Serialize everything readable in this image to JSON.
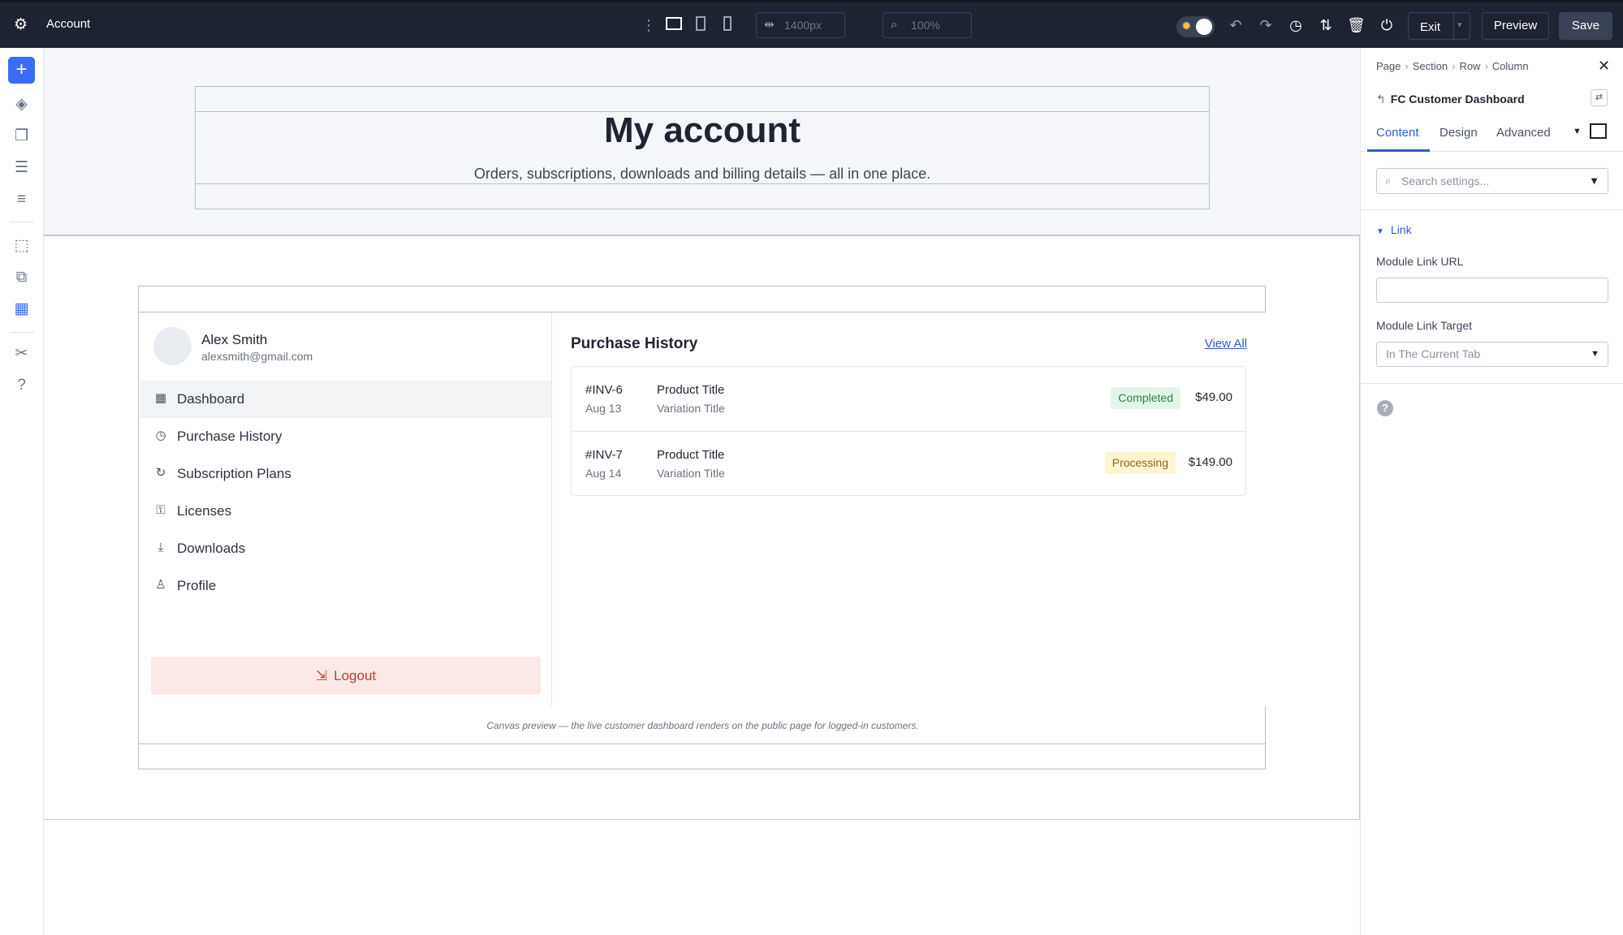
{
  "app": {
    "title": "Account"
  },
  "toolbar": {
    "width_value": "1400px",
    "zoom_value": "100%",
    "exit_label": "Exit",
    "preview_label": "Preview",
    "save_label": "Save"
  },
  "hero": {
    "title": "My account",
    "subtitle": "Orders, subscriptions, downloads and billing details — all in one place."
  },
  "user": {
    "name": "Alex Smith",
    "email": "alexsmith@gmail.com"
  },
  "nav": {
    "items": [
      {
        "label": "Dashboard",
        "icon": "grid-icon",
        "active": true
      },
      {
        "label": "Purchase History",
        "icon": "clock-icon"
      },
      {
        "label": "Subscription Plans",
        "icon": "refresh-icon"
      },
      {
        "label": "Licenses",
        "icon": "key-icon"
      },
      {
        "label": "Downloads",
        "icon": "download-icon"
      },
      {
        "label": "Profile",
        "icon": "user-icon"
      }
    ],
    "logout_label": "Logout"
  },
  "purchases": {
    "title": "Purchase History",
    "view_all": "View All",
    "orders": [
      {
        "id": "#INV-6",
        "date": "Aug 13",
        "product": "Product Title",
        "variation": "Variation Title",
        "status": "Completed",
        "price": "$49.00"
      },
      {
        "id": "#INV-7",
        "date": "Aug 14",
        "product": "Product Title",
        "variation": "Variation Title",
        "status": "Processing",
        "price": "$149.00"
      }
    ]
  },
  "caption": "Canvas preview — the live customer dashboard renders on the public page for logged-in customers.",
  "panel": {
    "breadcrumbs": [
      "Page",
      "Section",
      "Row",
      "Column"
    ],
    "module_name": "FC Customer Dashboard",
    "tabs": [
      "Content",
      "Design",
      "Advanced"
    ],
    "active_tab": "Content",
    "search_placeholder": "Search settings...",
    "group_label": "Link",
    "link_url_label": "Module Link URL",
    "link_url_value": "",
    "link_target_label": "Module Link Target",
    "link_target_value": "In The Current Tab"
  },
  "colors": {
    "accent": "#3b6cf6",
    "topbar": "#1d2331",
    "completed_bg": "#e3f5e9",
    "processing_bg": "#fdf5d2",
    "logout_bg": "#fbe9e7"
  }
}
